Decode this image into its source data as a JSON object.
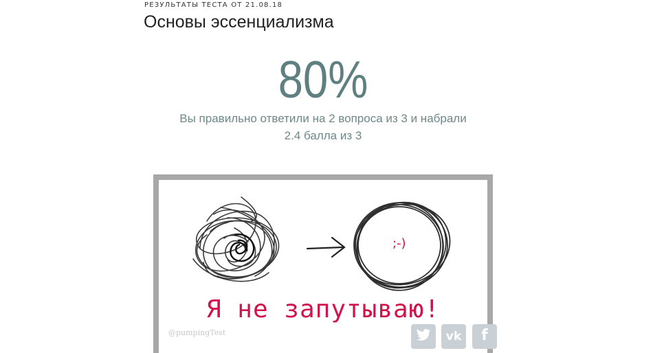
{
  "header": {
    "eyebrow": "РЕЗУЛЬТАТЫ ТЕСТА ОТ 21.08.18",
    "title": "Основы эссенциализма"
  },
  "result": {
    "percent": "80%",
    "summary_line1": "Вы правильно ответили на 2 вопроса из 3 и набрали",
    "summary_line2": "2.4 балла из 3"
  },
  "illustration": {
    "smiley": ";-)",
    "slogan": "Я не запутываю!",
    "watermark": "@pumpingTest"
  },
  "share": {
    "icons": [
      "twitter-icon",
      "vk-icon",
      "facebook-icon"
    ],
    "glyphs": [
      "🐦",
      "vk",
      "f"
    ]
  },
  "colors": {
    "accent": "#5f8080",
    "slogan": "#d1124b",
    "frame": "#a8a8a8"
  }
}
